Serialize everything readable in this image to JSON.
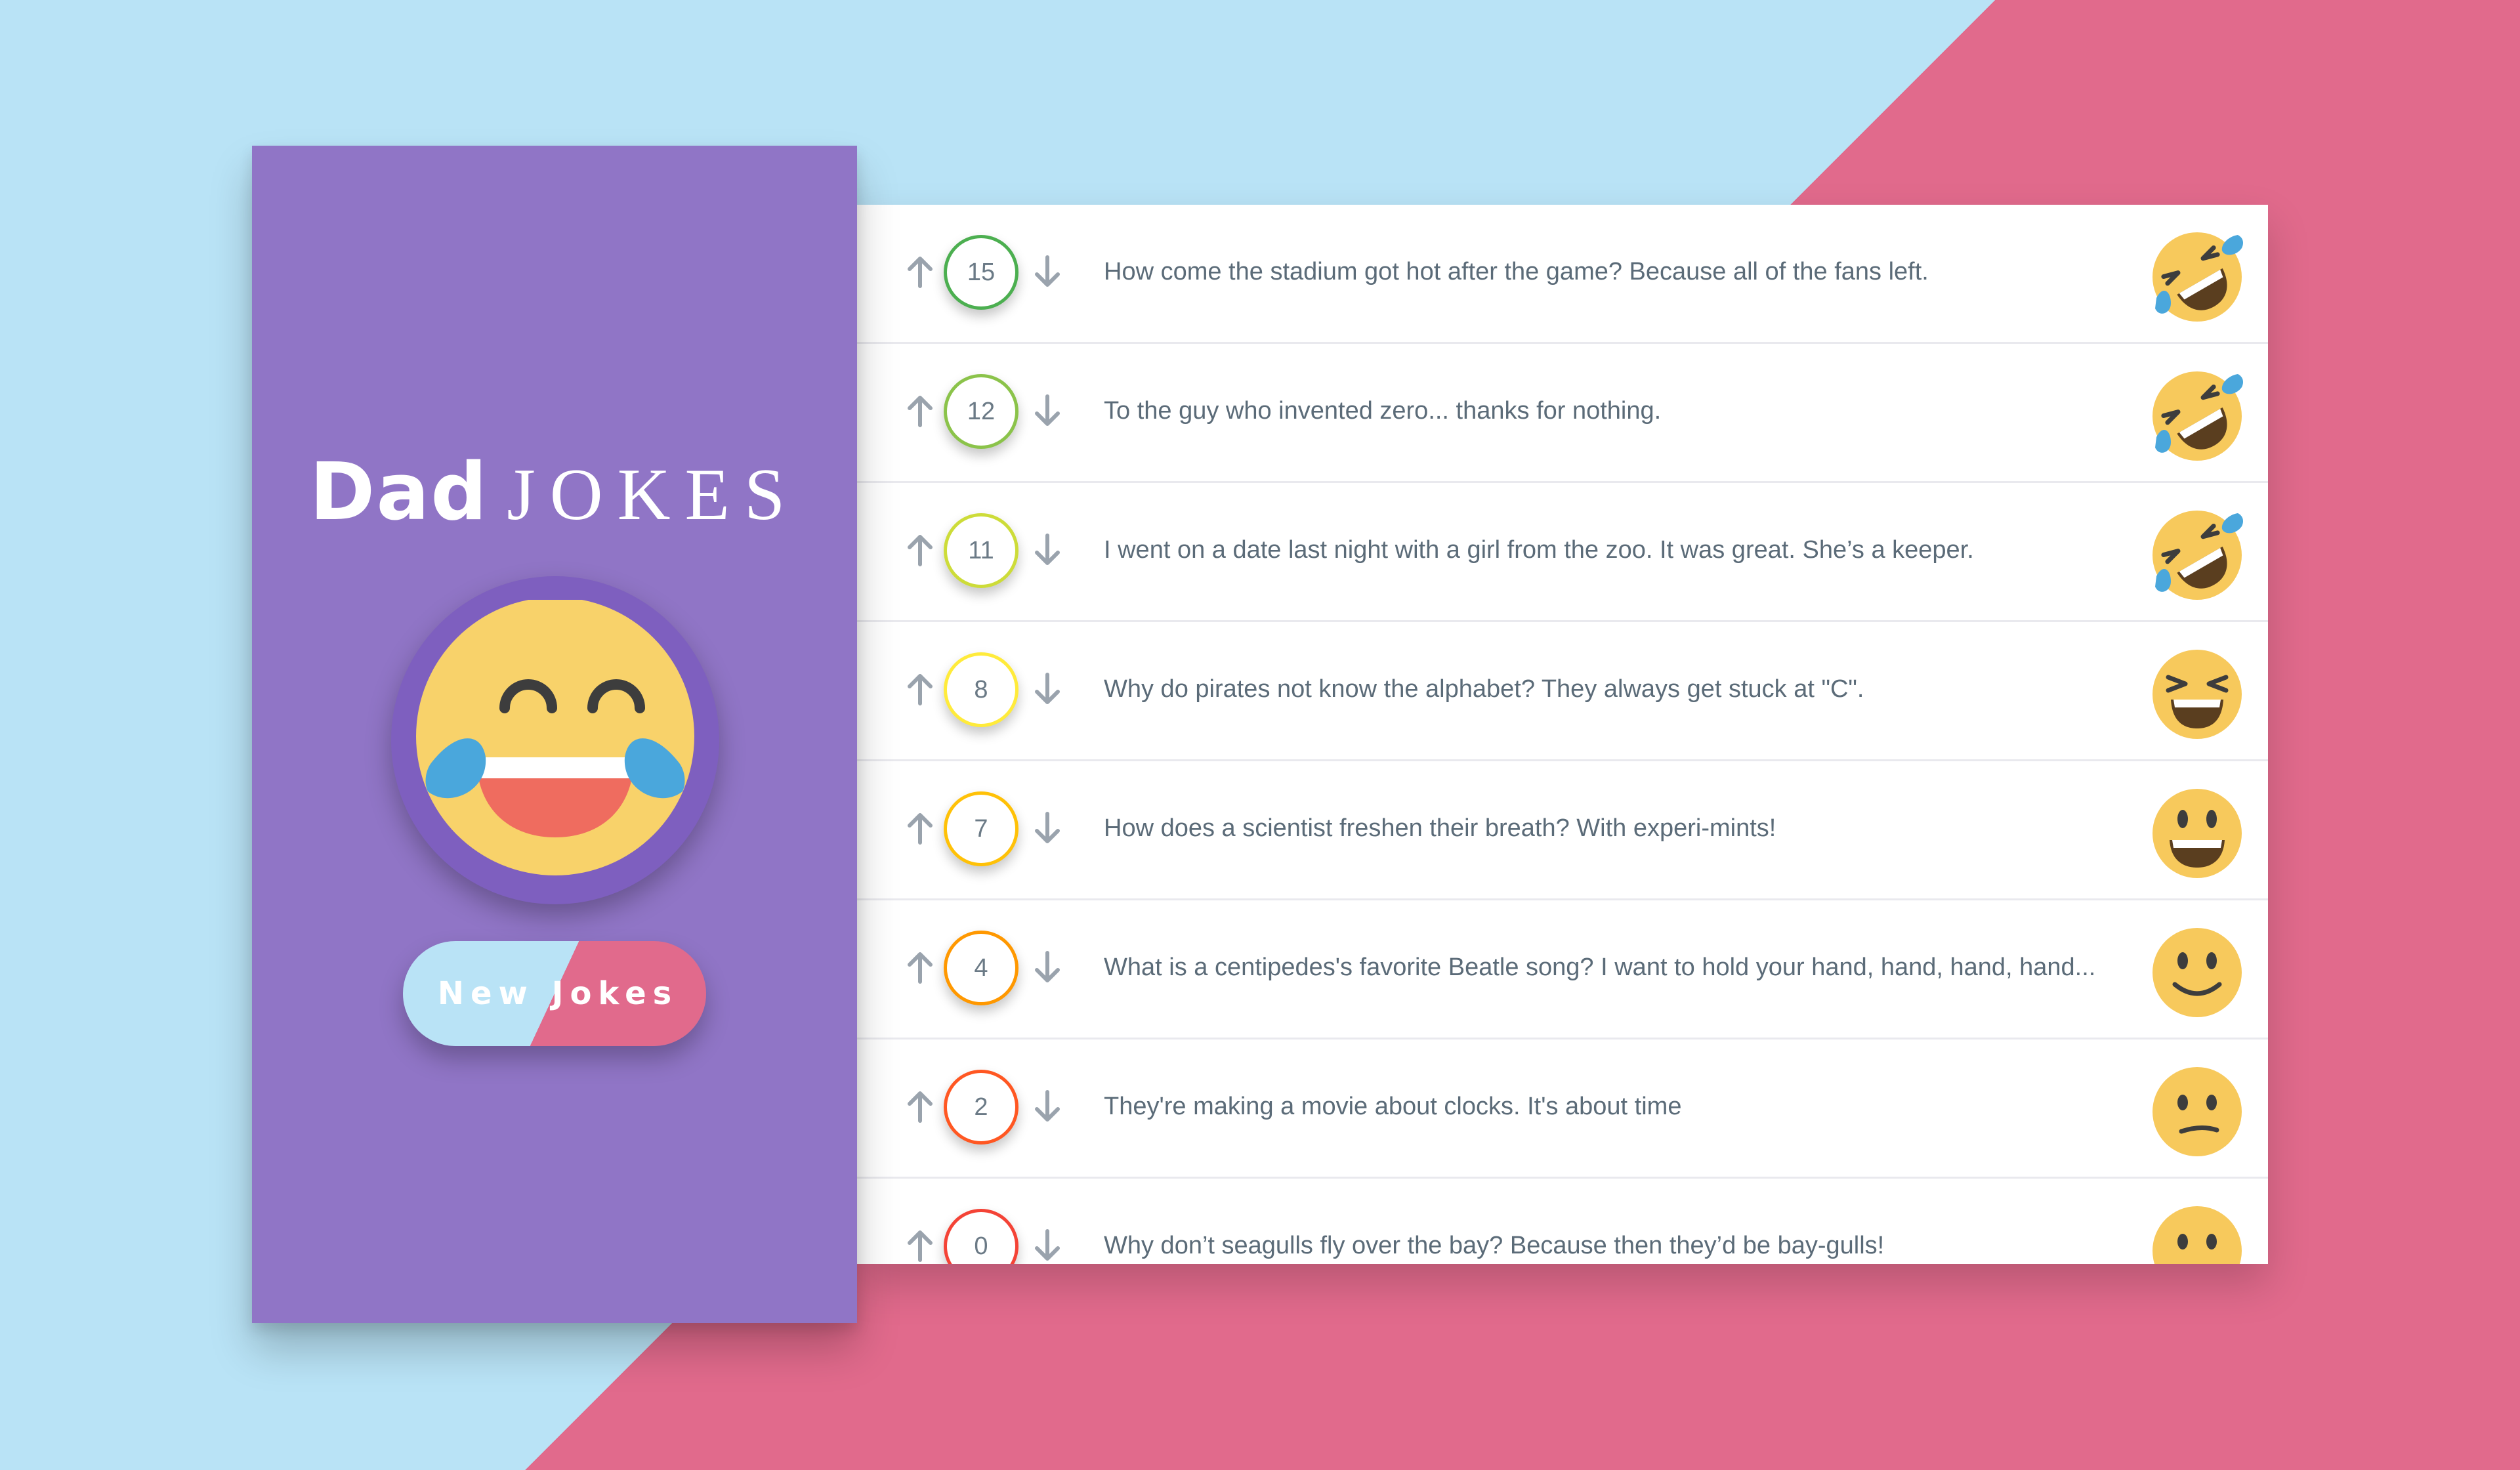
{
  "sidebar": {
    "title_bold": "Dad",
    "title_light": "JOKES",
    "button_label": "New Jokes"
  },
  "colors": {
    "sidebar_bg": "#9075c6",
    "accent_blue": "#b9e3f6",
    "accent_pink": "#e16a8c"
  },
  "jokes": [
    {
      "score": "15",
      "text": "How come the stadium got hot after the game? Because all of the fans left.",
      "border": "#4caf50",
      "face": "rofl-icon"
    },
    {
      "score": "12",
      "text": "To the guy who invented zero... thanks for nothing.",
      "border": "#8bc34a",
      "face": "rofl-icon"
    },
    {
      "score": "11",
      "text": "I went on a date last night with a girl from the zoo. It was great. She’s a keeper.",
      "border": "#cddc39",
      "face": "rofl-icon"
    },
    {
      "score": "8",
      "text": "Why do pirates not know the alphabet? They always get stuck at \"C\".",
      "border": "#ffeb3b",
      "face": "laughing-squint-icon"
    },
    {
      "score": "7",
      "text": "How does a scientist freshen their breath? With experi-mints!",
      "border": "#ffc107",
      "face": "grinning-icon"
    },
    {
      "score": "4",
      "text": "What is a centipedes's favorite Beatle song? I want to hold your hand, hand, hand, hand...",
      "border": "#ff9800",
      "face": "smiling-icon"
    },
    {
      "score": "2",
      "text": "They're making a movie about clocks. It's about time",
      "border": "#ff5722",
      "face": "confused-icon"
    },
    {
      "score": "0",
      "text": "Why don’t seagulls fly over the bay? Because then they’d be bay-gulls!",
      "border": "#f44336",
      "face": "confused-icon"
    }
  ]
}
